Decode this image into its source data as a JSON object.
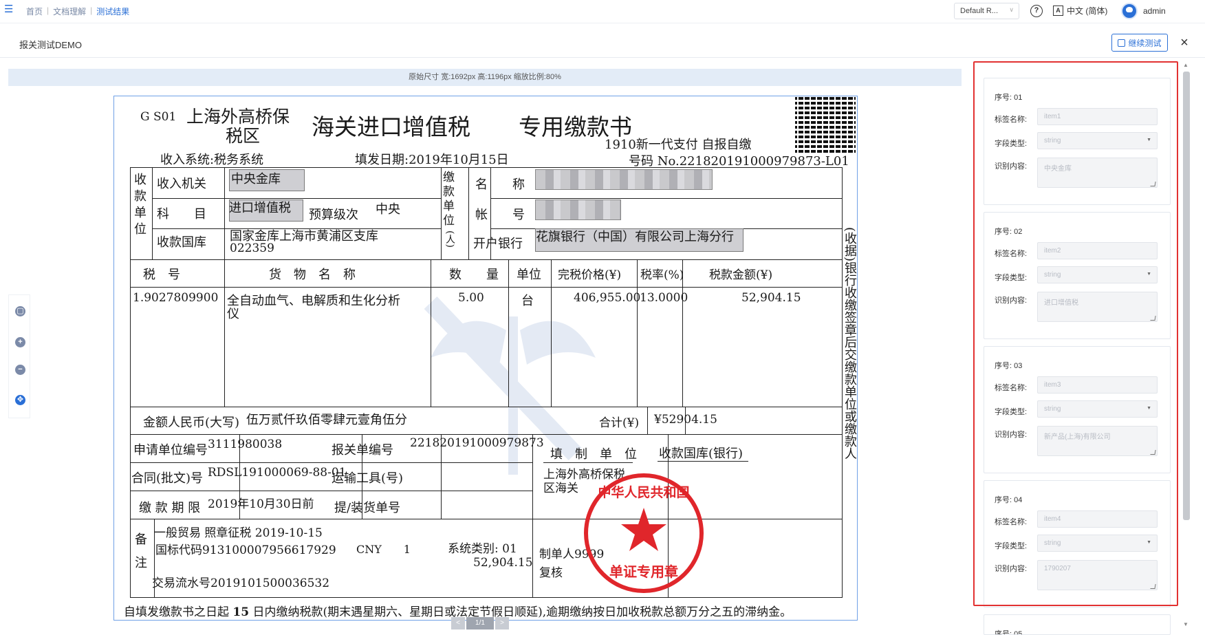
{
  "topbar": {
    "breadcrumb": [
      "首页",
      "文档理解",
      "测试结果"
    ],
    "profile_select": "Default R...",
    "help_label": "?",
    "language": "中文 (简体)",
    "language_icon": "A",
    "user": "admin"
  },
  "subbar": {
    "title": "报关测试DEMO",
    "continue_button": "继续测试",
    "close": "×"
  },
  "preview": {
    "info": "原始尺寸 宽:1692px 高:1196px   缩放比例:80%",
    "pager": {
      "prev": "<",
      "page": "1/1",
      "next": ">"
    }
  },
  "document": {
    "code": "G S01",
    "customs_name_1": "上海外高桥保",
    "customs_name_2": "税区",
    "title": "海关进口增值税",
    "title_right": "专用缴款书",
    "sub_right": "1910新一代支付  自报自缴",
    "number": "号码 No.221820191000979873-L01",
    "income_system": "收入系统:税务系统",
    "fill_date": "填发日期:2019年10月15日",
    "payee_label": [
      "收",
      "款",
      "单",
      "位"
    ],
    "payer_label": [
      "缴",
      "款",
      "单",
      "位"
    ],
    "payer_label_paren": "(人)",
    "receiving_org_label": "收入机关",
    "receiving_org": "中央金库",
    "subject_label": "科　　目",
    "subject": "进口增值税",
    "budget_level_label": "预算级次",
    "budget_level": "中央",
    "treasury_label": "收款国库",
    "treasury": "国家金库上海市黄浦区支库",
    "treasury_code": "022359",
    "name_label": "名　　称",
    "account_label": "帐　　号",
    "bank_label": "开户银行",
    "bank": "花旗银行（中国）有限公司上海分行",
    "side_text": "(收据)银行收缴签章后交缴款单位或缴款人",
    "headers": [
      "税　号",
      "货　物　名　称",
      "数　　量",
      "单位",
      "完税价格(¥)",
      "税率(%)",
      "税款金额(¥)"
    ],
    "row": {
      "tax_no": "1.9027809900",
      "goods_1": "全自动血气、电解质和生化分析",
      "goods_2": "仪",
      "qty": "5.00",
      "unit": "台",
      "value": "406,955.00",
      "rate": "13.0000",
      "tax": "52,904.15"
    },
    "amount_words_label": "金额人民币(大写)",
    "amount_words": "伍万贰仟玖佰零肆元壹角伍分",
    "total_label": "合计(¥)",
    "total": "¥52904.15",
    "applicant_no_label": "申请单位编号",
    "applicant_no": "3111980038",
    "declaration_no_label": "报关单编号",
    "declaration_no": "221820191000979873",
    "contract_label": "合同(批文)号",
    "contract": "RDSL191000069-88-01",
    "transport_label": "运输工具(号)",
    "deadline_label": "缴 款 期 限",
    "deadline": "2019年10月30日前",
    "bill_label": "提/装货单号",
    "issuer_label": "填　制　单　位",
    "treasury_bank_label": "收款国库(银行)",
    "issuer_text_1": "上海外高桥保税",
    "issuer_text_2": "区海关",
    "maker": "制单人9999",
    "reviewer": "复核",
    "remark_label": [
      "备",
      "注"
    ],
    "remark_1": "一般贸易 照章征税 2019-10-15",
    "remark_2": "国标代码913100007956617929",
    "remark_currency": "CNY　　1",
    "remark_system": "系统类别: 01",
    "remark_amount": "52,904.15",
    "remark_serial": "交易流水号2019101500036532",
    "seal_text": "单证专用章",
    "footer_pre": "自填发缴款书之日起",
    "footer_days": "15",
    "footer_post": "日内缴纳税款(期末遇星期六、星期日或法定节假日顺延),逾期缴纳按日加收税款总额万分之五的滞纳金。"
  },
  "panel": {
    "seq_label": "序号:",
    "tag_label": "标签名称:",
    "type_label": "字段类型:",
    "content_label": "识别内容:",
    "items": [
      {
        "seq": "01",
        "tag": "item1",
        "type": "string",
        "content": "中央金库"
      },
      {
        "seq": "02",
        "tag": "item2",
        "type": "string",
        "content": "进口增值税"
      },
      {
        "seq": "03",
        "tag": "item3",
        "type": "string",
        "content": "新产品(上海)有限公司"
      },
      {
        "seq": "04",
        "tag": "item4",
        "type": "string",
        "content": "1790207"
      }
    ],
    "next_seq": "05"
  },
  "colors": {
    "accent": "#2a6fd6",
    "highlight": "#e23131",
    "seal": "#e0262b"
  }
}
